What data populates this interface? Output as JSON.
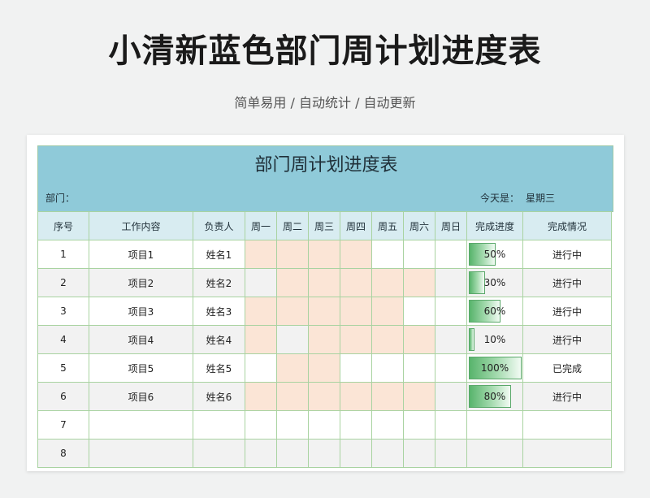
{
  "header": {
    "title": "小清新蓝色部门周计划进度表",
    "subtitle": "简单易用 / 自动统计 / 自动更新"
  },
  "sheet": {
    "title": "部门周计划进度表",
    "dept_label": "部门：",
    "today_label": "今天是：",
    "today_value": "星期三"
  },
  "columns": [
    "序号",
    "工作内容",
    "负责人",
    "周一",
    "周二",
    "周三",
    "周四",
    "周五",
    "周六",
    "周日",
    "完成进度",
    "完成情况"
  ],
  "rows": [
    {
      "no": "1",
      "task": "项目1",
      "owner": "姓名1",
      "days": [
        1,
        1,
        1,
        1,
        0,
        0,
        0
      ],
      "progress": 50,
      "progress_label": "50%",
      "status": "进行中"
    },
    {
      "no": "2",
      "task": "项目2",
      "owner": "姓名2",
      "days": [
        0,
        1,
        1,
        1,
        1,
        1,
        0
      ],
      "progress": 30,
      "progress_label": "30%",
      "status": "进行中"
    },
    {
      "no": "3",
      "task": "项目3",
      "owner": "姓名3",
      "days": [
        1,
        1,
        1,
        1,
        1,
        0,
        0
      ],
      "progress": 60,
      "progress_label": "60%",
      "status": "进行中"
    },
    {
      "no": "4",
      "task": "项目4",
      "owner": "姓名4",
      "days": [
        1,
        0,
        1,
        1,
        1,
        1,
        0
      ],
      "progress": 10,
      "progress_label": "10%",
      "status": "进行中"
    },
    {
      "no": "5",
      "task": "项目5",
      "owner": "姓名5",
      "days": [
        0,
        1,
        1,
        0,
        0,
        0,
        0
      ],
      "progress": 100,
      "progress_label": "100%",
      "status": "已完成"
    },
    {
      "no": "6",
      "task": "项目6",
      "owner": "姓名6",
      "days": [
        1,
        1,
        1,
        1,
        1,
        1,
        0
      ],
      "progress": 80,
      "progress_label": "80%",
      "status": "进行中"
    },
    {
      "no": "7",
      "task": "",
      "owner": "",
      "days": [
        0,
        0,
        0,
        0,
        0,
        0,
        0
      ],
      "progress": null,
      "progress_label": "",
      "status": ""
    },
    {
      "no": "8",
      "task": "",
      "owner": "",
      "days": [
        0,
        0,
        0,
        0,
        0,
        0,
        0
      ],
      "progress": null,
      "progress_label": "",
      "status": ""
    }
  ],
  "colors": {
    "header_band": "#8fcad9",
    "column_header": "#d8ecf1",
    "planned_fill": "#fbe5d6",
    "progress_bar": "#58b46c",
    "grid_line": "#a9d3a1"
  }
}
